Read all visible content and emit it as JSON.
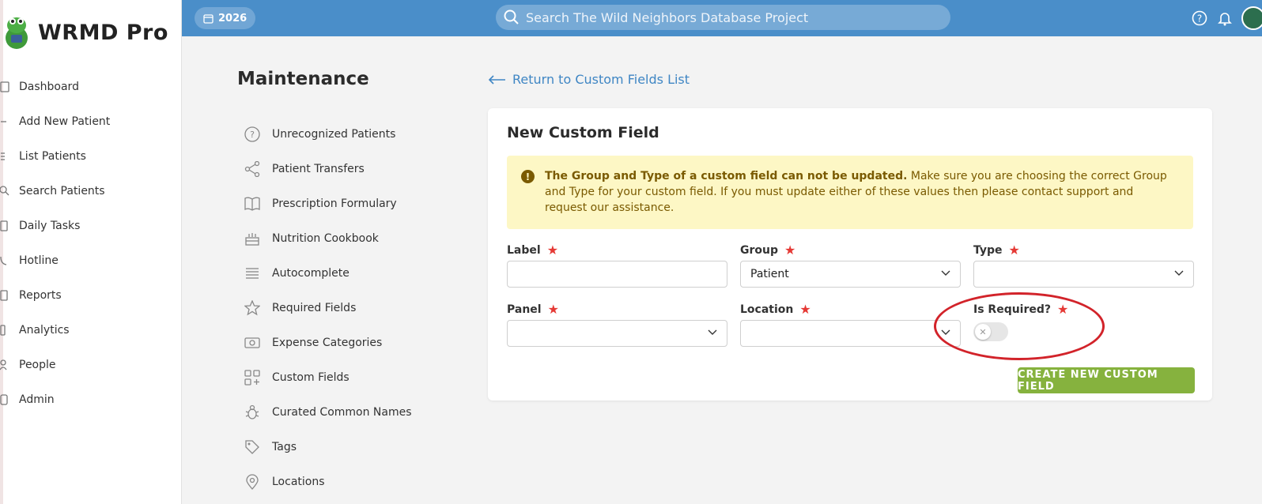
{
  "sidebar": {
    "brand": "WRMD Pro",
    "items": [
      {
        "label": "Dashboard",
        "icon": "dashboard-icon"
      },
      {
        "label": "Add New Patient",
        "icon": "plus-icon"
      },
      {
        "label": "List Patients",
        "icon": "list-icon"
      },
      {
        "label": "Search Patients",
        "icon": "search-icon"
      },
      {
        "label": "Daily Tasks",
        "icon": "tasks-icon"
      },
      {
        "label": "Hotline",
        "icon": "hotline-icon"
      },
      {
        "label": "Reports",
        "icon": "reports-icon"
      },
      {
        "label": "Analytics",
        "icon": "analytics-icon"
      },
      {
        "label": "People",
        "icon": "people-icon"
      },
      {
        "label": "Admin",
        "icon": "admin-icon"
      }
    ]
  },
  "topbar": {
    "year": "2026",
    "search_placeholder": "Search The Wild Neighbors Database Project"
  },
  "maintenance": {
    "title": "Maintenance",
    "items": [
      {
        "label": "Unrecognized Patients",
        "icon": "question-circle-icon"
      },
      {
        "label": "Patient Transfers",
        "icon": "share-icon"
      },
      {
        "label": "Prescription Formulary",
        "icon": "book-icon"
      },
      {
        "label": "Nutrition Cookbook",
        "icon": "cake-icon"
      },
      {
        "label": "Autocomplete",
        "icon": "lines-icon"
      },
      {
        "label": "Required Fields",
        "icon": "star-icon"
      },
      {
        "label": "Expense Categories",
        "icon": "money-icon"
      },
      {
        "label": "Custom Fields",
        "icon": "grid-plus-icon"
      },
      {
        "label": "Curated Common Names",
        "icon": "bug-icon"
      },
      {
        "label": "Tags",
        "icon": "tag-icon"
      },
      {
        "label": "Locations",
        "icon": "map-pin-icon"
      }
    ]
  },
  "back_link": "Return to Custom Fields List",
  "form": {
    "title": "New Custom Field",
    "alert_bold": "The Group and Type of a custom field can not be updated.",
    "alert_text": " Make sure you are choosing the correct Group and Type for your custom field. If you must update either of these values then please contact support and request our assistance.",
    "label_label": "Label",
    "label_value": "",
    "group_label": "Group",
    "group_value": "Patient",
    "type_label": "Type",
    "type_value": "",
    "panel_label": "Panel",
    "panel_value": "",
    "location_label": "Location",
    "location_value": "",
    "required_label": "Is Required?",
    "required_on": false,
    "submit_label": "CREATE NEW CUSTOM FIELD"
  },
  "colors": {
    "topbar": "#4a8ec9",
    "accent_link": "#3f86c4",
    "submit": "#86b23e",
    "required_star": "#e53935",
    "alert_bg": "#fdf7c5",
    "annotation": "#d2232a"
  }
}
